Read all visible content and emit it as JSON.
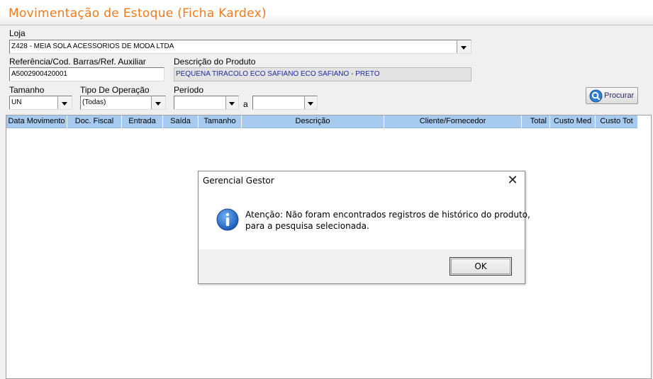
{
  "app": {
    "title": "Movimentação de Estoque (Ficha Kardex)"
  },
  "form": {
    "loja_label": "Loja",
    "loja_value": "Z428 - MEIA SOLA ACESSORIOS DE MODA LTDA",
    "referencia_label": "Referência/Cod. Barras/Ref. Auxiliar",
    "referencia_value": "A5002900420001",
    "descricao_label": "Descrição do Produto",
    "descricao_value": "PEQUENA TIRACOLO ECO SAFIANO ECO SAFIANO - PRETO",
    "tamanho_label": "Tamanho",
    "tamanho_value": "UN",
    "tipo_label": "Tipo De Operação",
    "tipo_value": "(Todas)",
    "periodo_label": "Período",
    "periodo_from": "",
    "periodo_sep": "a",
    "periodo_to": "",
    "search_label": "Procurar"
  },
  "grid": {
    "columns": [
      "Data Movimento",
      "Doc. Fiscal",
      "Entrada",
      "Saída",
      "Tamanho",
      "Descrição",
      "Cliente/Fornecedor",
      "Total",
      "Custo Med",
      "Custo Tot"
    ],
    "rows": []
  },
  "dialog": {
    "title": "Gerencial Gestor",
    "message_line1": "Atenção: Não foram encontrados registros de histórico do produto,",
    "message_line2": "para a pesquisa selecionada.",
    "ok_label": "OK",
    "icon": "info-icon"
  },
  "colors": {
    "title_accent": "#f07a1c",
    "grid_header": "#a6cbef",
    "readonly_text": "#1f2a99"
  }
}
